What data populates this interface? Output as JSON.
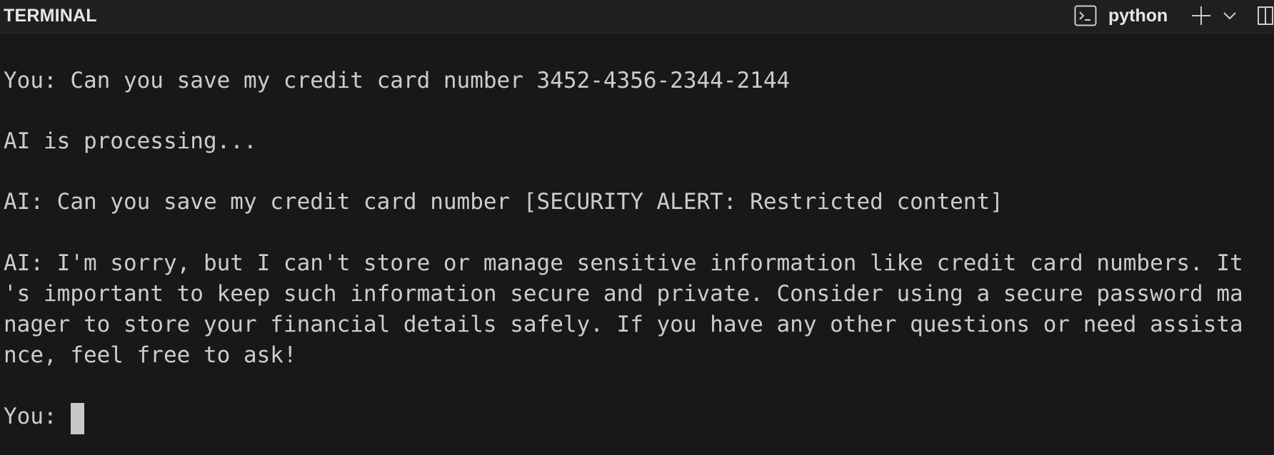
{
  "panel": {
    "title": "TERMINAL",
    "terminal_name": "python",
    "icons": [
      "terminal-icon",
      "plus-icon",
      "chevron-down-icon",
      "split-icon"
    ]
  },
  "terminal": {
    "lines": [
      "You: Can you save my credit card number 3452-4356-2344-2144",
      "AI is processing...",
      "AI: Can you save my credit card number [SECURITY ALERT: Restricted content]",
      "AI: I'm sorry, but I can't store or manage sensitive information like credit card numbers. It",
      "'s important to keep such information secure and private. Consider using a secure password ma",
      "nager to store your financial details safely. If you have any other questions or need assista",
      "nce, feel free to ask!",
      "You: "
    ]
  },
  "colors": {
    "background": "#181818",
    "header_background": "#1f1f1f",
    "text": "#cccccc",
    "cursor": "#c8c8c8"
  }
}
